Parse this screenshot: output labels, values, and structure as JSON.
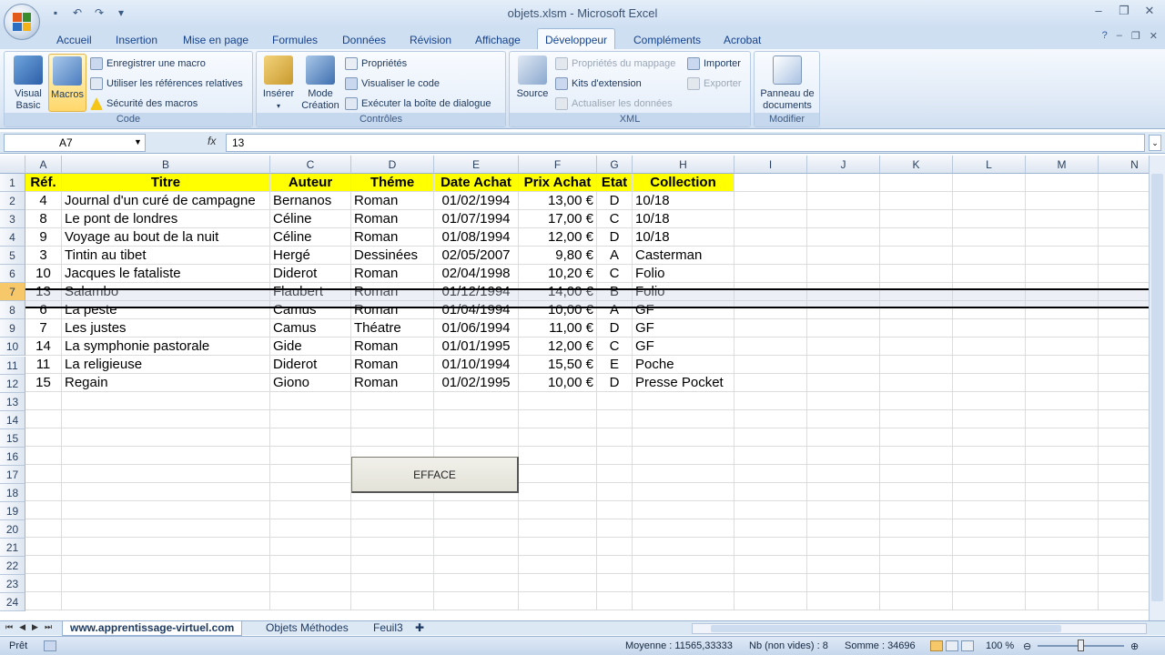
{
  "window": {
    "title": "objets.xlsm - Microsoft Excel"
  },
  "ribbon_tabs": [
    "Accueil",
    "Insertion",
    "Mise en page",
    "Formules",
    "Données",
    "Révision",
    "Affichage",
    "Développeur",
    "Compléments",
    "Acrobat"
  ],
  "active_tab": "Développeur",
  "groups": {
    "code": {
      "label": "Code",
      "visual_basic_l1": "Visual",
      "visual_basic_l2": "Basic",
      "macros": "Macros",
      "record_macro": "Enregistrer une macro",
      "relative_refs": "Utiliser les références relatives",
      "macro_security": "Sécurité des macros"
    },
    "controls": {
      "label": "Contrôles",
      "insert": "Insérer",
      "design_mode_l1": "Mode",
      "design_mode_l2": "Création",
      "properties": "Propriétés",
      "view_code": "Visualiser le code",
      "run_dialog": "Exécuter la boîte de dialogue"
    },
    "xml": {
      "label": "XML",
      "source": "Source",
      "map_props": "Propriétés du mappage",
      "ext_packs": "Kits d'extension",
      "refresh": "Actualiser les données",
      "import": "Importer",
      "export": "Exporter"
    },
    "modify": {
      "label": "Modifier",
      "doc_panel_l1": "Panneau de",
      "doc_panel_l2": "documents"
    }
  },
  "formula_bar": {
    "name_box": "A7",
    "fx": "fx",
    "value": "13"
  },
  "columns": [
    "A",
    "B",
    "C",
    "D",
    "E",
    "F",
    "G",
    "H",
    "I",
    "J",
    "K",
    "L",
    "M",
    "N"
  ],
  "row_numbers": [
    "1",
    "2",
    "3",
    "4",
    "5",
    "6",
    "7",
    "8",
    "9",
    "10",
    "11",
    "12",
    "13",
    "14",
    "15",
    "16",
    "17",
    "18",
    "19",
    "20",
    "21",
    "22",
    "23",
    "24"
  ],
  "table": {
    "headers": [
      "Réf.",
      "Titre",
      "Auteur",
      "Théme",
      "Date Achat",
      "Prix Achat",
      "Etat",
      "Collection"
    ],
    "rows": [
      [
        "4",
        "Journal d'un curé de campagne",
        "Bernanos",
        "Roman",
        "01/02/1994",
        "13,00 €",
        "D",
        "10/18"
      ],
      [
        "8",
        "Le pont de londres",
        "Céline",
        "Roman",
        "01/07/1994",
        "17,00 €",
        "C",
        "10/18"
      ],
      [
        "9",
        "Voyage au bout de la nuit",
        "Céline",
        "Roman",
        "01/08/1994",
        "12,00 €",
        "D",
        "10/18"
      ],
      [
        "3",
        "Tintin au tibet",
        "Hergé",
        "Dessinées",
        "02/05/2007",
        "9,80 €",
        "A",
        "Casterman"
      ],
      [
        "10",
        "Jacques le fataliste",
        "Diderot",
        "Roman",
        "02/04/1998",
        "10,20 €",
        "C",
        "Folio"
      ],
      [
        "13",
        "Salambo",
        "Flaubert",
        "Roman",
        "01/12/1994",
        "14,00 €",
        "B",
        "Folio"
      ],
      [
        "6",
        "La peste",
        "Camus",
        "Roman",
        "01/04/1994",
        "10,00 €",
        "A",
        "GF"
      ],
      [
        "7",
        "Les justes",
        "Camus",
        "Théatre",
        "01/06/1994",
        "11,00 €",
        "D",
        "GF"
      ],
      [
        "14",
        "La symphonie pastorale",
        "Gide",
        "Roman",
        "01/01/1995",
        "12,00 €",
        "C",
        "GF"
      ],
      [
        "11",
        "La religieuse",
        "Diderot",
        "Roman",
        "01/10/1994",
        "15,50 €",
        "E",
        "Poche"
      ],
      [
        "15",
        "Regain",
        "Giono",
        "Roman",
        "01/02/1995",
        "10,00 €",
        "D",
        "Presse Pocket"
      ]
    ]
  },
  "button": {
    "label": "EFFACE"
  },
  "sheet_tabs": [
    "www.apprentissage-virtuel.com",
    "Objets Méthodes",
    "Feuil3"
  ],
  "status": {
    "ready": "Prêt",
    "average": "Moyenne : 11565,33333",
    "count": "Nb (non vides) : 8",
    "sum": "Somme : 34696",
    "zoom": "100 %"
  },
  "colors": {
    "header_fill": "#ffff00",
    "ribbon_blue": "#cfdff2",
    "active_row_border": "#000000"
  }
}
